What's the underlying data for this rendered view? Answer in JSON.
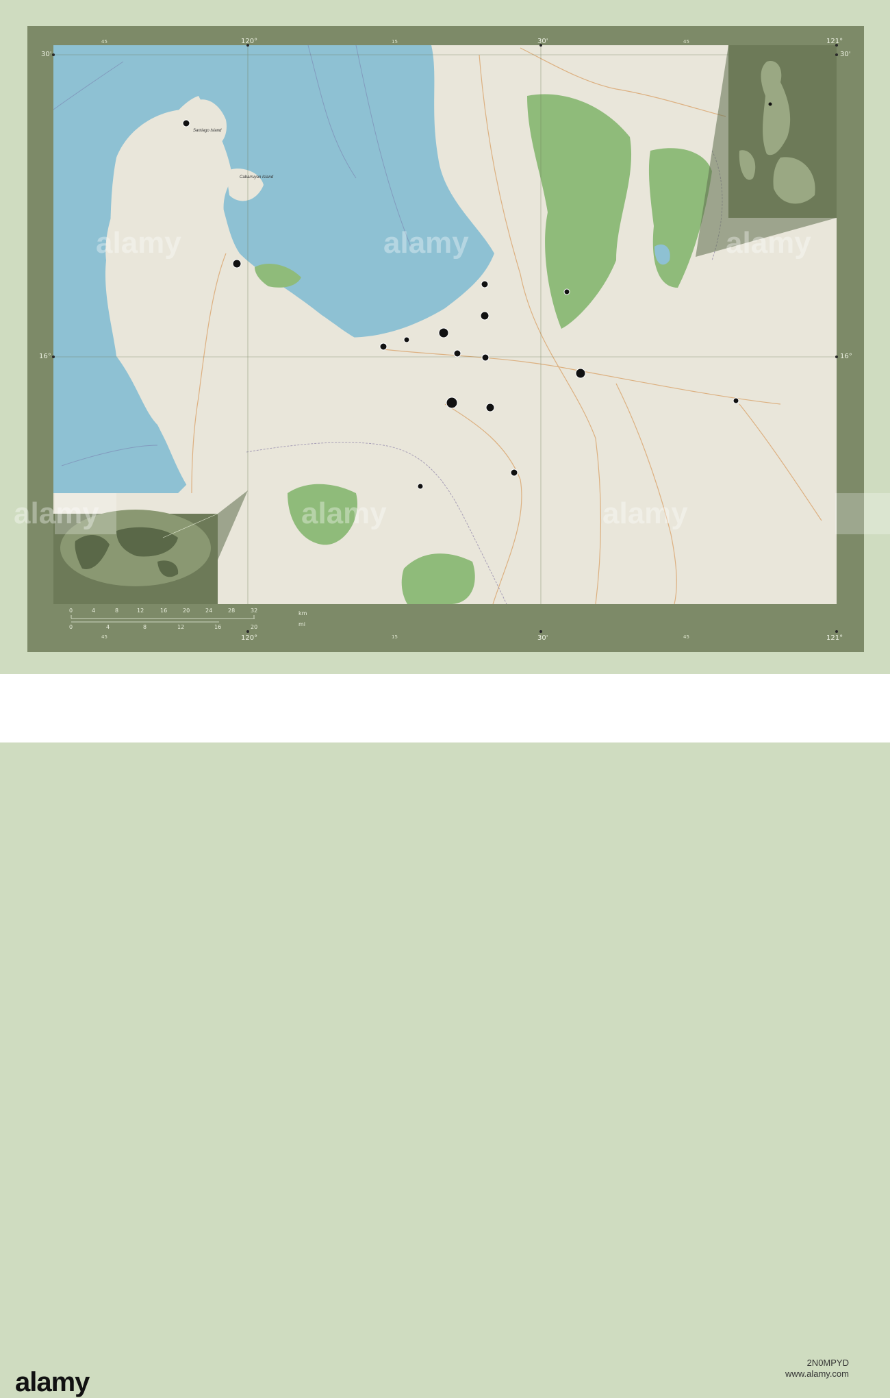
{
  "map": {
    "graticule_labels": {
      "top": [
        "120°",
        "30'",
        "121°"
      ],
      "bottom": [
        "120°",
        "30'",
        "121°"
      ],
      "left": [
        "30'",
        "16°"
      ],
      "right": [
        "30'",
        "16°"
      ],
      "minor_top": [
        "45",
        "15",
        "45"
      ],
      "minor_bottom": [
        "45",
        "15",
        "45"
      ]
    },
    "place_labels": [
      "Cabarruyan Island",
      "Santiago Island"
    ],
    "scale_bar": {
      "km_ticks": [
        "0",
        "4",
        "8",
        "12",
        "16",
        "20",
        "24",
        "28",
        "32"
      ],
      "km_unit": "km",
      "mi_ticks": [
        "0",
        "4",
        "8",
        "12",
        "16",
        "20"
      ],
      "mi_unit": "mi"
    },
    "colors": {
      "sea": "#8ec1d3",
      "land": "#e9e6da",
      "forest": "#8fbb7a",
      "frame": "#7d8a68",
      "inset": "#5f6d4e"
    }
  },
  "watermark": {
    "logo": "alamy",
    "overlay_text": "alamy",
    "image_id": "2N0MPYD",
    "url": "www.alamy.com"
  }
}
